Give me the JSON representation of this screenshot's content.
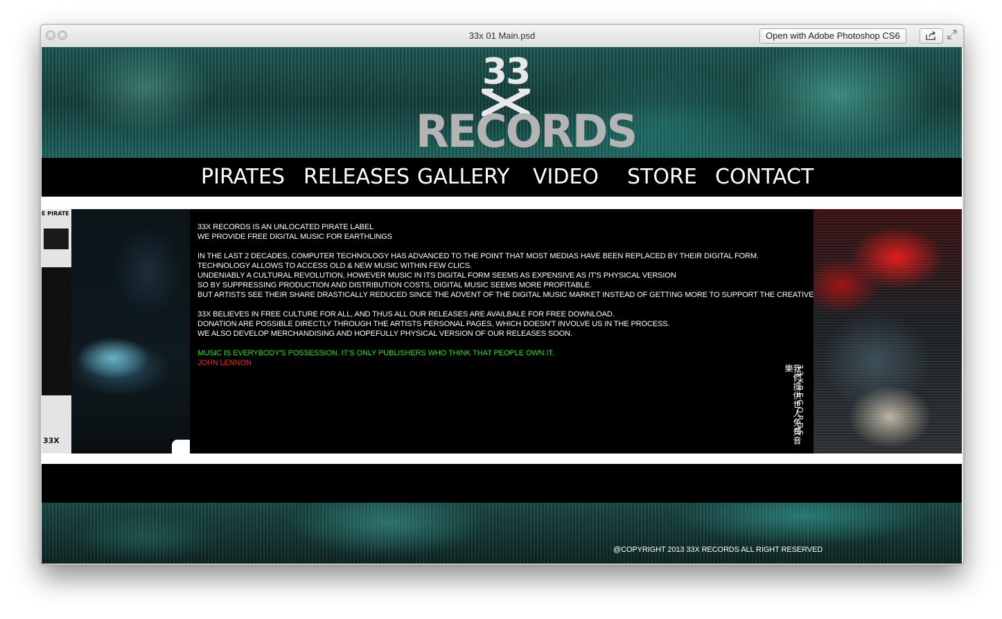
{
  "window": {
    "title": "33x 01 Main.psd",
    "open_with_label": "Open with Adobe Photoshop CS6",
    "close_symbol": "×",
    "zoom_symbol": "+"
  },
  "site": {
    "logo": {
      "number": "33",
      "word": "RECORDS"
    },
    "nav": [
      "PIRATES",
      "RELEASES",
      "GALLERY",
      "VIDEO",
      "STORE",
      "CONTACT"
    ],
    "paragraphs": [
      [
        "33X RECORDS IS AN UNLOCATED PIRATE LABEL",
        "WE PROVIDE FREE DIGITAL MUSIC FOR EARTHLINGS"
      ],
      [
        "IN THE LAST 2 DECADES, COMPUTER TECHNOLOGY HAS ADVANCED TO THE POINT THAT MOST MEDIAS HAVE BEEN REPLACED BY THEIR DIGITAL FORM.",
        "TECHNOLOGY ALLOWS TO ACCESS OLD & NEW MUSIC WITHIN FEW CLICS.",
        "UNDENIABLY A CULTURAL REVOLUTION, HOWEVER MUSIC IN ITS DIGITAL FORM SEEMS AS EXPENSIVE AS IT'S PHYSICAL VERSION",
        "SO BY SUPPRESSING PRODUCTION AND DISTRIBUTION COSTS, DIGITAL MUSIC SEEMS MORE PROFITABLE.",
        "BUT ARTISTS SEE THEIR SHARE DRASTICALLY REDUCED SINCE THE ADVENT OF THE DIGITAL MUSIC MARKET INSTEAD OF GETTING MORE TO SUPPORT THE CREATIVE PROCESS."
      ],
      [
        "33X BELIEVES IN FREE CULTURE FOR ALL, AND THUS ALL OUR RELEASES ARE AVAILBALE FOR FREE DOWNLOAD.",
        "DONATION ARE POSSIBLE DIRECTLY THROUGH THE ARTISTS PERSONAL PAGES, WHICH DOESN'T INVOLVE US IN THE PROCESS.",
        "WE ALSO DEVELOP MERCHANDISING AND HOPEFULLY PHYSICAL VERSION OF OUR RELEASES SOON."
      ]
    ],
    "quote": "MUSIC IS EVERYBODY'S POSSESSION. IT'S ONLY PUBLISHERS WHO THINK THAT PEOPLE OWN IT.",
    "quote_author": "JOHN LENNON",
    "vertical_chinese": "我們提供世人免費音樂",
    "vertical_english": "33XRECORDS",
    "album_left_top": "E PIRATE",
    "album_left_bottom": "33X",
    "copyright": "@COPYRIGHT 2013 33X RECORDS ALL RIGHT RESERVED"
  },
  "colors": {
    "quote": "#1fe01f",
    "author": "#ff1f1f",
    "teal": "#1e5a56"
  }
}
